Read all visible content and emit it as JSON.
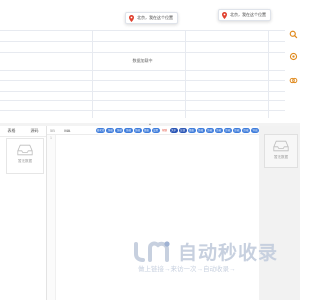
{
  "map_panel": {
    "tooltip_left": "北京，我在这个位置",
    "tooltip_right": "北京，我在这个位置",
    "no_data": "数据加载中",
    "rail_icons": [
      "search-icon",
      "settings-icon",
      "link-icon"
    ]
  },
  "bottom_left": {
    "tabs": [
      "表格",
      "源码"
    ],
    "empty_label": "暂无数据"
  },
  "editor": {
    "tool_a": "5B",
    "tool_b": "MA",
    "chips": [
      "格式化代码",
      "压缩代码",
      "压缩代码",
      "压缩代码",
      "压缩代码",
      "图表",
      "设置",
      "帮助",
      "关于",
      "反馈",
      "图表",
      "压缩代码",
      "压缩代码",
      "压缩代码",
      "压缩代码",
      "压缩代码",
      "压缩代码",
      "导出"
    ],
    "line_number": "1"
  },
  "right_panel": {
    "empty_label": "暂无数据"
  },
  "watermark": {
    "title": "自动秒收录",
    "subtitle": "做上链接→来访一次→自动收录→"
  },
  "colors": {
    "accent": "#3f7ddc",
    "pin": "#e0412f",
    "rail": "#e08a1e"
  }
}
